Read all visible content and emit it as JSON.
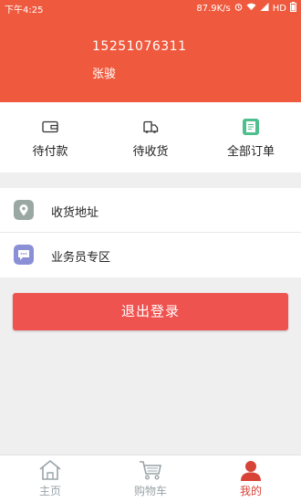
{
  "status_bar": {
    "time": "下午4:25",
    "speed": "87.9K/s",
    "network": "HD"
  },
  "profile": {
    "phone": "15251076311",
    "name": "张骏"
  },
  "orders": {
    "items": [
      {
        "label": "待付款",
        "icon": "wallet-icon"
      },
      {
        "label": "待收货",
        "icon": "truck-icon"
      },
      {
        "label": "全部订单",
        "icon": "order-list-icon"
      }
    ]
  },
  "menu": {
    "items": [
      {
        "label": "收货地址",
        "icon": "location-pin-icon"
      },
      {
        "label": "业务员专区",
        "icon": "chat-bubble-icon"
      }
    ]
  },
  "logout_label": "退出登录",
  "tabbar": {
    "items": [
      {
        "label": "主页",
        "icon": "home-icon"
      },
      {
        "label": "购物车",
        "icon": "cart-icon"
      },
      {
        "label": "我的",
        "icon": "user-icon",
        "active": true
      }
    ]
  },
  "colors": {
    "brand": "#ef5a3e",
    "button": "#ef5350",
    "active_tab": "#d84338",
    "inactive_tab": "#9aa3a8"
  }
}
